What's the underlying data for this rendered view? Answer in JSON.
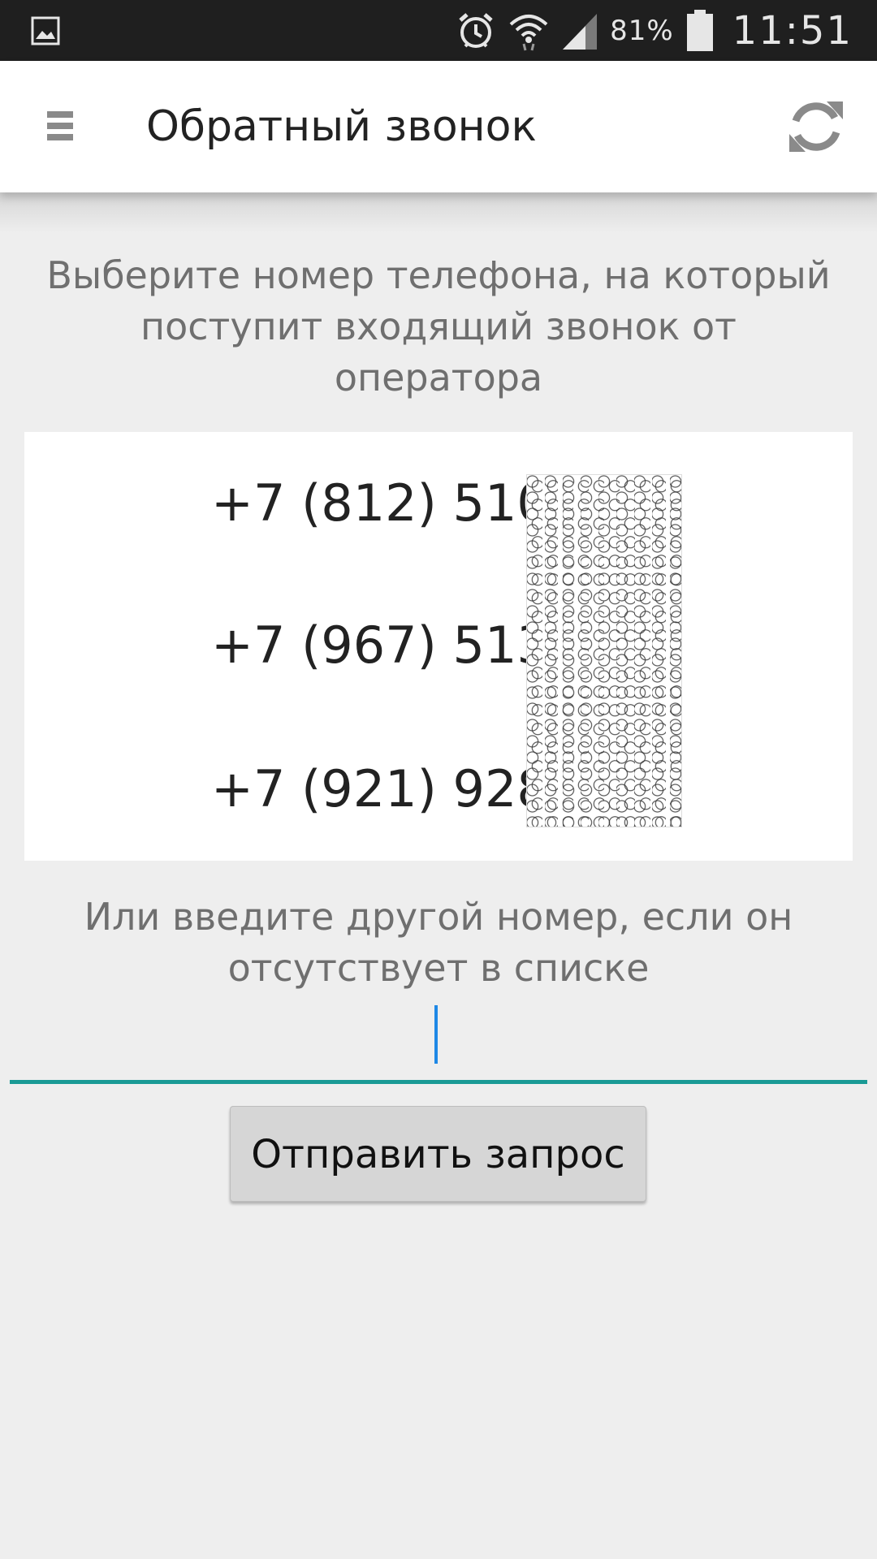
{
  "status_bar": {
    "battery_percent": "81%",
    "time": "11:51",
    "icons": [
      "gallery-icon",
      "alarm-icon",
      "wifi-icon",
      "signal-icon",
      "battery-icon"
    ]
  },
  "app_bar": {
    "title": "Обратный звонок",
    "menu_icon": "menu-icon",
    "refresh_icon": "refresh-icon"
  },
  "prompt": {
    "select_number_text": "Выберите номер телефона, на который поступит входящий звонок от оператора"
  },
  "phone_numbers": [
    "+7 (812) 510-",
    "+7 (967) 513-",
    "+7 (921) 928-"
  ],
  "other_number": {
    "text": "Или введите другой номер, если он отсутствует в списке",
    "input_value": "",
    "input_placeholder": ""
  },
  "submit": {
    "label": "Отправить запрос"
  },
  "colors": {
    "accent_underline": "#1a9a95",
    "caret": "#1e88e5",
    "background": "#eeeeee",
    "status_bar": "#1f1f1f"
  }
}
